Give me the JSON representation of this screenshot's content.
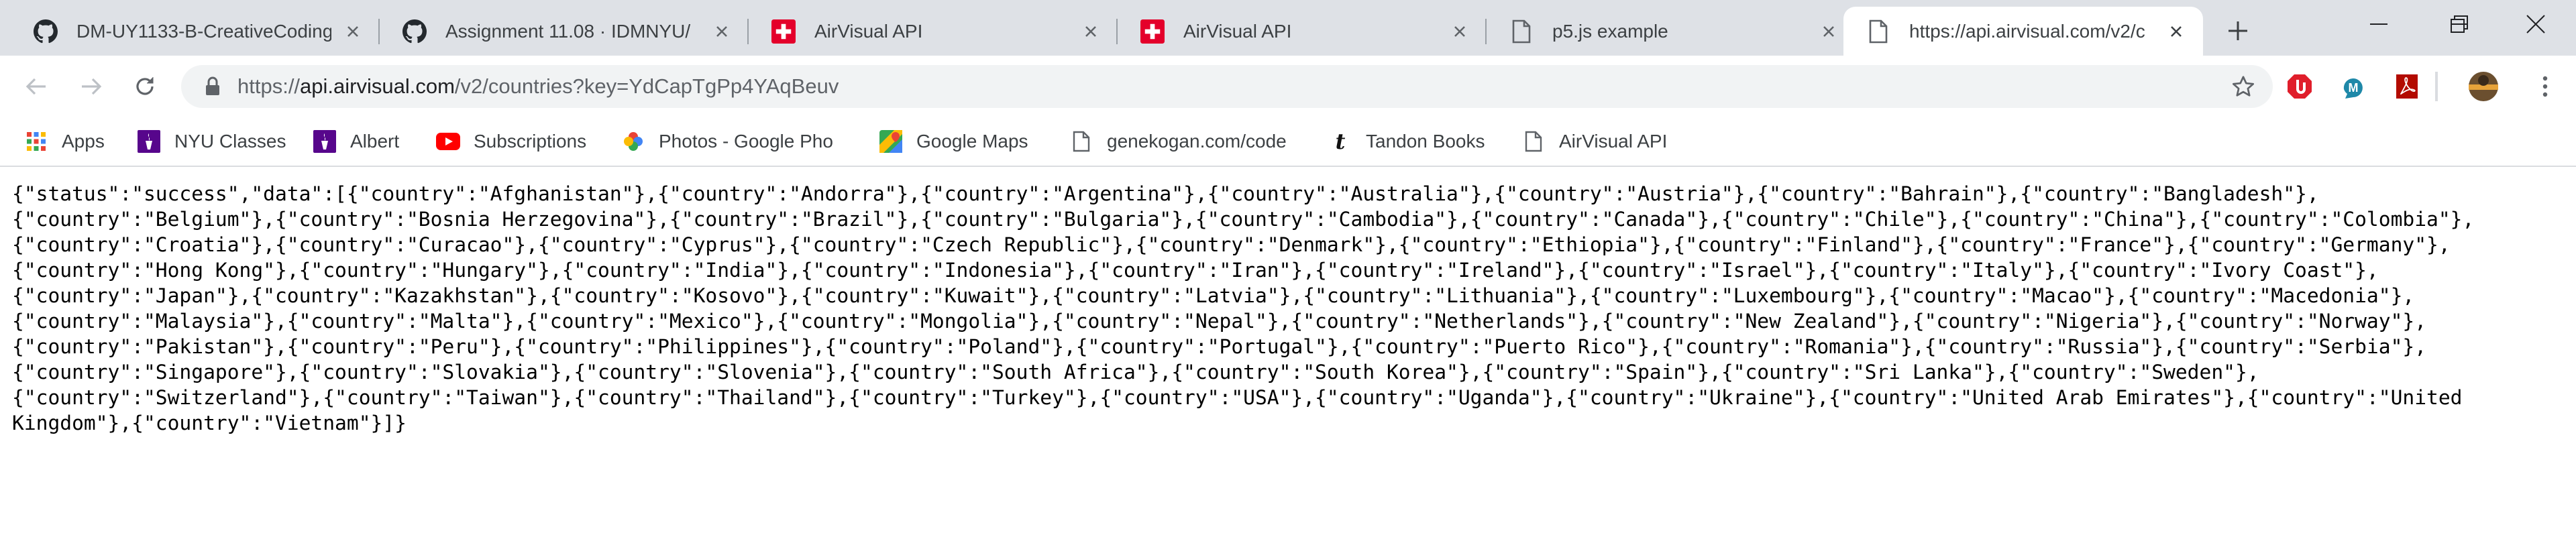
{
  "tabs": [
    {
      "title": "DM-UY1133-B-CreativeCoding",
      "favicon": "github-icon"
    },
    {
      "title": "Assignment 11.08 · IDMNYU/",
      "favicon": "github-icon"
    },
    {
      "title": "AirVisual API",
      "favicon": "swiss-flag-icon"
    },
    {
      "title": "AirVisual API",
      "favicon": "swiss-flag-icon"
    },
    {
      "title": "p5.js example",
      "favicon": "document-icon"
    },
    {
      "title": "https://api.airvisual.com/v2/c",
      "favicon": "document-icon",
      "active": true
    }
  ],
  "toolbar": {
    "url_prefix": "https://",
    "url_host": "api.airvisual.com",
    "url_path": "/v2/countries?key=YdCapTgPp4YAqBeuv"
  },
  "bookmarks": [
    {
      "label": "Apps",
      "icon": "apps-grid-icon"
    },
    {
      "label": "NYU Classes",
      "icon": "nyu-torch-icon"
    },
    {
      "label": "Albert",
      "icon": "nyu-torch-icon"
    },
    {
      "label": "Subscriptions",
      "icon": "youtube-icon"
    },
    {
      "label": "Photos - Google Pho",
      "icon": "google-photos-icon"
    },
    {
      "label": "Google Maps",
      "icon": "google-maps-icon"
    },
    {
      "label": "genekogan.com/code",
      "icon": "document-icon"
    },
    {
      "label": "Tandon Books",
      "icon": "tandon-t-icon"
    },
    {
      "label": "AirVisual API",
      "icon": "document-icon"
    }
  ],
  "content": {
    "json_text": "{\"status\":\"success\",\"data\":[{\"country\":\"Afghanistan\"},{\"country\":\"Andorra\"},{\"country\":\"Argentina\"},{\"country\":\"Australia\"},{\"country\":\"Austria\"},{\"country\":\"Bahrain\"},{\"country\":\"Bangladesh\"},\n{\"country\":\"Belgium\"},{\"country\":\"Bosnia Herzegovina\"},{\"country\":\"Brazil\"},{\"country\":\"Bulgaria\"},{\"country\":\"Cambodia\"},{\"country\":\"Canada\"},{\"country\":\"Chile\"},{\"country\":\"China\"},{\"country\":\"Colombia\"},\n{\"country\":\"Croatia\"},{\"country\":\"Curacao\"},{\"country\":\"Cyprus\"},{\"country\":\"Czech Republic\"},{\"country\":\"Denmark\"},{\"country\":\"Ethiopia\"},{\"country\":\"Finland\"},{\"country\":\"France\"},{\"country\":\"Germany\"},\n{\"country\":\"Hong Kong\"},{\"country\":\"Hungary\"},{\"country\":\"India\"},{\"country\":\"Indonesia\"},{\"country\":\"Iran\"},{\"country\":\"Ireland\"},{\"country\":\"Israel\"},{\"country\":\"Italy\"},{\"country\":\"Ivory Coast\"},\n{\"country\":\"Japan\"},{\"country\":\"Kazakhstan\"},{\"country\":\"Kosovo\"},{\"country\":\"Kuwait\"},{\"country\":\"Latvia\"},{\"country\":\"Lithuania\"},{\"country\":\"Luxembourg\"},{\"country\":\"Macao\"},{\"country\":\"Macedonia\"},\n{\"country\":\"Malaysia\"},{\"country\":\"Malta\"},{\"country\":\"Mexico\"},{\"country\":\"Mongolia\"},{\"country\":\"Nepal\"},{\"country\":\"Netherlands\"},{\"country\":\"New Zealand\"},{\"country\":\"Nigeria\"},{\"country\":\"Norway\"},\n{\"country\":\"Pakistan\"},{\"country\":\"Peru\"},{\"country\":\"Philippines\"},{\"country\":\"Poland\"},{\"country\":\"Portugal\"},{\"country\":\"Puerto Rico\"},{\"country\":\"Romania\"},{\"country\":\"Russia\"},{\"country\":\"Serbia\"},\n{\"country\":\"Singapore\"},{\"country\":\"Slovakia\"},{\"country\":\"Slovenia\"},{\"country\":\"South Africa\"},{\"country\":\"South Korea\"},{\"country\":\"Spain\"},{\"country\":\"Sri Lanka\"},{\"country\":\"Sweden\"},\n{\"country\":\"Switzerland\"},{\"country\":\"Taiwan\"},{\"country\":\"Thailand\"},{\"country\":\"Turkey\"},{\"country\":\"USA\"},{\"country\":\"Uganda\"},{\"country\":\"Ukraine\"},{\"country\":\"United Arab Emirates\"},{\"country\":\"United\nKingdom\"},{\"country\":\"Vietnam\"}]}"
  },
  "colors": {
    "tabstrip_bg": "#dee1e6",
    "omnibox_bg": "#f1f3f4",
    "swiss_red": "#e4002b",
    "youtube_red": "#ff0000",
    "nyu_purple": "#57068c"
  }
}
